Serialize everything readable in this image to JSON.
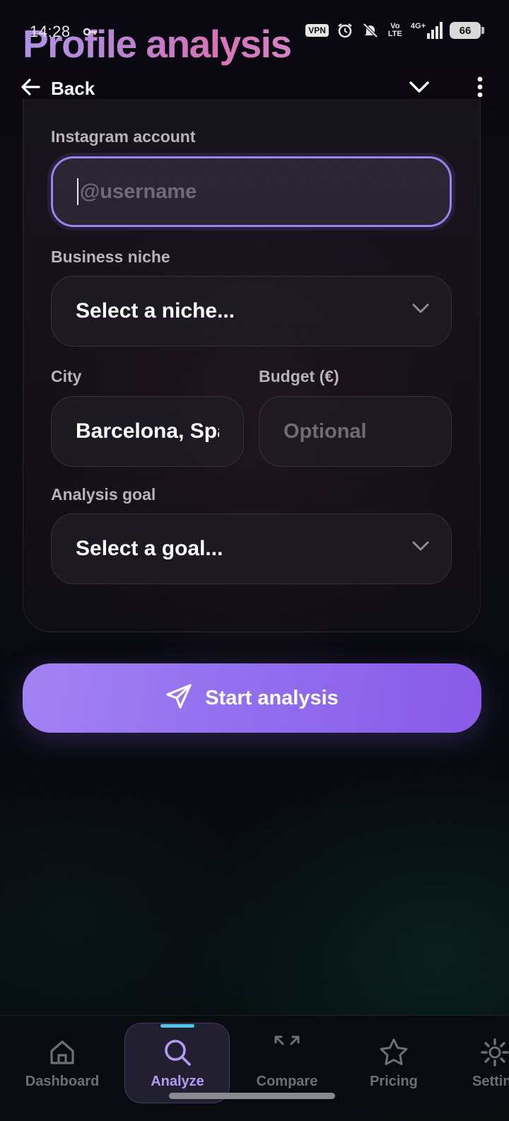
{
  "status_bar": {
    "time": "14:28",
    "vpn": "VPN",
    "network": "Vo LTE",
    "signal": "4G+",
    "battery": "66"
  },
  "header": {
    "title": "Profile analysis",
    "back_label": "Back"
  },
  "form": {
    "instagram": {
      "label": "Instagram account",
      "placeholder": "@username",
      "value": ""
    },
    "niche": {
      "label": "Business niche",
      "value": "Select a niche..."
    },
    "city": {
      "label": "City",
      "value": "Barcelona, Spa"
    },
    "budget": {
      "label": "Budget (€)",
      "placeholder": "Optional"
    },
    "goal": {
      "label": "Analysis goal",
      "value": "Select a goal..."
    }
  },
  "start_button": {
    "label": "Start analysis"
  },
  "nav": {
    "items": [
      {
        "label": "Dashboard",
        "icon": "home-icon"
      },
      {
        "label": "Analyze",
        "icon": "search-icon",
        "active": true
      },
      {
        "label": "Compare",
        "icon": "compare-arrows-icon"
      },
      {
        "label": "Pricing",
        "icon": "star-icon"
      },
      {
        "label": "Settings",
        "icon": "gear-icon"
      }
    ]
  },
  "colors": {
    "accent": "#9a82f0",
    "button": "#9270ef",
    "indicator": "#4fc4e8"
  }
}
